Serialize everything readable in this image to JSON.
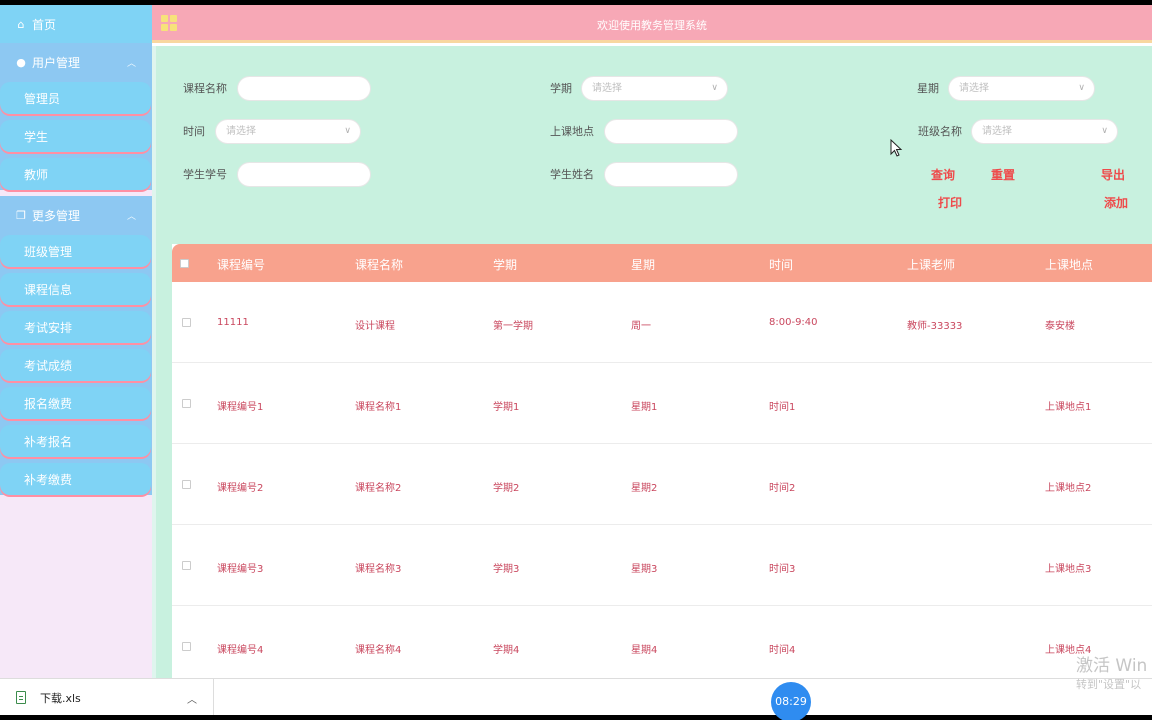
{
  "header": {
    "title": "欢迎使用教务管理系统"
  },
  "sidebar": {
    "home": "首页",
    "group_user": "用户管理",
    "user_items": [
      "管理员",
      "学生",
      "教师"
    ],
    "group_more": "更多管理",
    "more_items": [
      "班级管理",
      "课程信息",
      "考试安排",
      "考试成绩",
      "报名缴费",
      "补考报名",
      "补考缴费"
    ]
  },
  "filters": {
    "course_name": "课程名称",
    "semester": "学期",
    "weekday": "星期",
    "time": "时间",
    "location": "上课地点",
    "class_name": "班级名称",
    "student_no": "学生学号",
    "student_name": "学生姓名",
    "select_placeholder": "请选择"
  },
  "actions": {
    "query": "查询",
    "reset": "重置",
    "export": "导出",
    "print": "打印",
    "add": "添加"
  },
  "table": {
    "headers": [
      "课程编号",
      "课程名称",
      "学期",
      "星期",
      "时间",
      "上课老师",
      "上课地点"
    ],
    "rows": [
      [
        "11111",
        "设计课程",
        "第一学期",
        "周一",
        "8:00-9:40",
        "教师-33333",
        "泰安楼"
      ],
      [
        "课程编号1",
        "课程名称1",
        "学期1",
        "星期1",
        "时间1",
        "",
        "上课地点1"
      ],
      [
        "课程编号2",
        "课程名称2",
        "学期2",
        "星期2",
        "时间2",
        "",
        "上课地点2"
      ],
      [
        "课程编号3",
        "课程名称3",
        "学期3",
        "星期3",
        "时间3",
        "",
        "上课地点3"
      ],
      [
        "课程编号4",
        "课程名称4",
        "学期4",
        "星期4",
        "时间4",
        "",
        "上课地点4"
      ]
    ]
  },
  "download": {
    "filename": "下载.xls"
  },
  "taskbar": {
    "time": "08:29"
  },
  "watermark": {
    "line1": "激活 Win",
    "line2": "转到\"设置\"以"
  }
}
